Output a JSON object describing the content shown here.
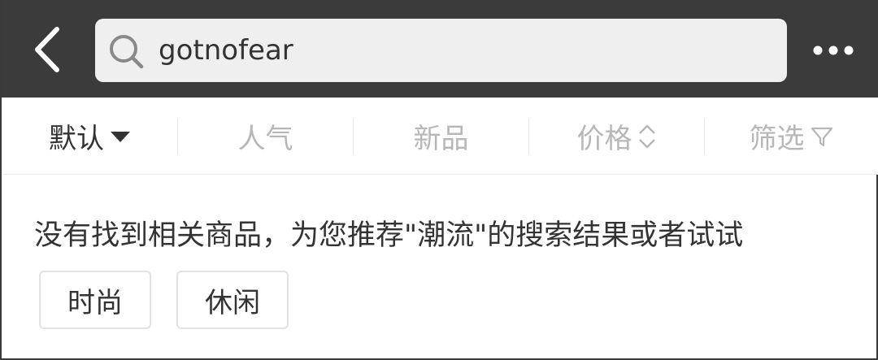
{
  "search": {
    "value": "gotnofear",
    "placeholder": ""
  },
  "sort_bar": {
    "items": [
      {
        "label": "默认",
        "active": true,
        "icon": "caret-down-icon"
      },
      {
        "label": "人气",
        "active": false
      },
      {
        "label": "新品",
        "active": false
      },
      {
        "label": "价格",
        "active": false,
        "icon": "sort-arrows-icon"
      },
      {
        "label": "筛选",
        "active": false,
        "icon": "filter-icon"
      }
    ]
  },
  "result": {
    "message": "没有找到相关商品，为您推荐\"潮流\"的搜索结果或者试试",
    "suggestions": [
      "时尚",
      "休闲"
    ]
  },
  "colors": {
    "nav_background": "#3b3b3b",
    "search_background": "#efefef",
    "active_text": "#333333",
    "inactive_text": "#b7b7b7"
  }
}
